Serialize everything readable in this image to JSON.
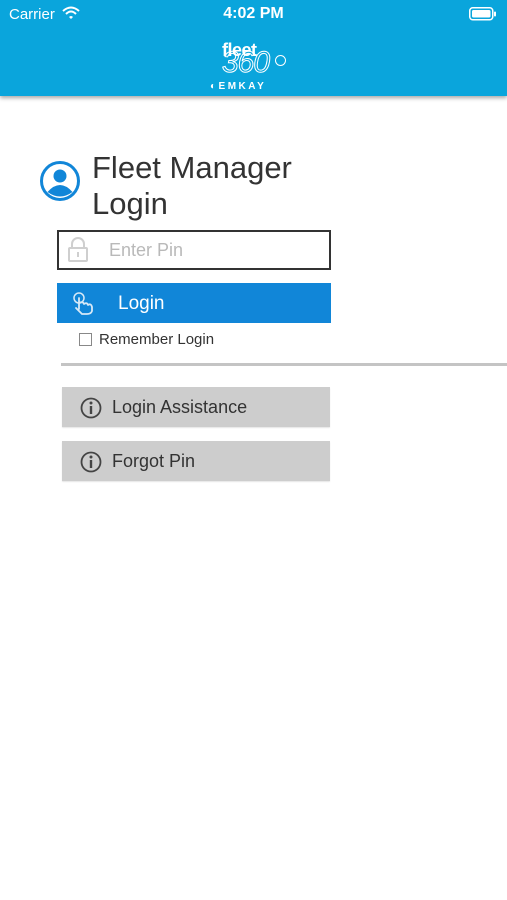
{
  "status_bar": {
    "carrier": "Carrier",
    "time": "4:02 PM"
  },
  "logo": {
    "fleet": "fleet",
    "number": "360",
    "brand": "EMKAY"
  },
  "login": {
    "title": "Fleet Manager Login",
    "pin_placeholder": "Enter Pin",
    "pin_value": "",
    "login_button": "Login",
    "remember_label": "Remember Login",
    "remember_checked": false
  },
  "help": {
    "assistance_button": "Login Assistance",
    "forgot_button": "Forgot Pin"
  },
  "colors": {
    "header_bg": "#0aa5dc",
    "login_button": "#1186d8",
    "secondary_button": "#cdcdcd",
    "accent_icon": "#1186d8"
  },
  "icons": [
    "wifi-icon",
    "battery-icon",
    "user-icon",
    "lock-icon",
    "touch-icon",
    "info-icon"
  ]
}
